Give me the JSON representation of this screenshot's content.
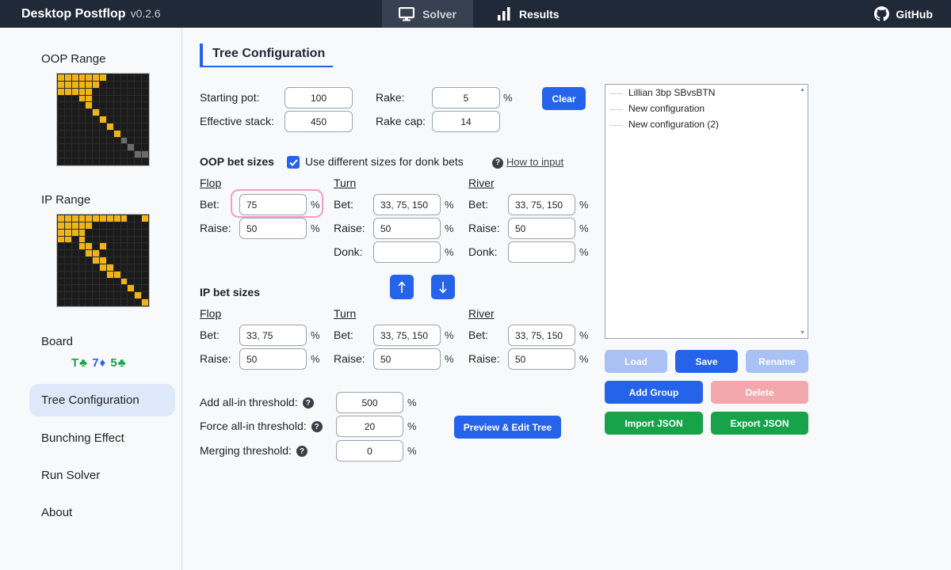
{
  "header": {
    "app_name": "Desktop Postflop",
    "version": "v0.2.6",
    "tabs": [
      {
        "label": "Solver",
        "icon": "monitor-icon",
        "active": true
      },
      {
        "label": "Results",
        "icon": "bar-chart-icon",
        "active": false
      }
    ],
    "github_label": "GitHub"
  },
  "sidebar": {
    "oop_range_label": "OOP Range",
    "ip_range_label": "IP Range",
    "board_label": "Board",
    "board_cards": [
      {
        "rank": "T",
        "suit": "♣",
        "color": "#16a34a"
      },
      {
        "rank": "7",
        "suit": "♦",
        "color": "#2563eb"
      },
      {
        "rank": "5",
        "suit": "♣",
        "color": "#16a34a"
      }
    ],
    "nav": [
      {
        "label": "Tree Configuration",
        "active": true
      },
      {
        "label": "Bunching Effect",
        "active": false
      },
      {
        "label": "Run Solver",
        "active": false
      },
      {
        "label": "About",
        "active": false
      }
    ]
  },
  "main": {
    "title": "Tree Configuration",
    "starting_pot": {
      "label": "Starting pot:",
      "value": "100"
    },
    "effective_stack": {
      "label": "Effective stack:",
      "value": "450"
    },
    "rake": {
      "label": "Rake:",
      "value": "5",
      "unit": "%"
    },
    "rake_cap": {
      "label": "Rake cap:",
      "value": "14"
    },
    "clear_label": "Clear",
    "oop": {
      "title": "OOP bet sizes",
      "donk_checkbox_label": "Use different sizes for donk bets",
      "donk_checked": true,
      "how_to_input": "How to input",
      "flop": {
        "label": "Flop",
        "bet_label": "Bet:",
        "bet": "75",
        "raise_label": "Raise:",
        "raise": "50"
      },
      "turn": {
        "label": "Turn",
        "bet_label": "Bet:",
        "bet": "33, 75, 150",
        "raise_label": "Raise:",
        "raise": "50",
        "donk_label": "Donk:",
        "donk": ""
      },
      "river": {
        "label": "River",
        "bet_label": "Bet:",
        "bet": "33, 75, 150",
        "raise_label": "Raise:",
        "raise": "50",
        "donk_label": "Donk:",
        "donk": ""
      }
    },
    "ip": {
      "title": "IP bet sizes",
      "flop": {
        "label": "Flop",
        "bet_label": "Bet:",
        "bet": "33, 75",
        "raise_label": "Raise:",
        "raise": "50"
      },
      "turn": {
        "label": "Turn",
        "bet_label": "Bet:",
        "bet": "33, 75, 150",
        "raise_label": "Raise:",
        "raise": "50"
      },
      "river": {
        "label": "River",
        "bet_label": "Bet:",
        "bet": "33, 75, 150",
        "raise_label": "Raise:",
        "raise": "50"
      }
    },
    "pct": "%",
    "add_allin": {
      "label": "Add all-in threshold:",
      "value": "500"
    },
    "force_allin": {
      "label": "Force all-in threshold:",
      "value": "20"
    },
    "merging": {
      "label": "Merging threshold:",
      "value": "0"
    },
    "preview_label": "Preview & Edit Tree"
  },
  "configs": {
    "items": [
      "Lillian 3bp SBvsBTN",
      "New configuration",
      "New configuration (2)"
    ],
    "buttons": {
      "load": "Load",
      "save": "Save",
      "rename": "Rename",
      "add_group": "Add Group",
      "delete": "Delete",
      "import_json": "Import JSON",
      "export_json": "Export JSON"
    }
  }
}
